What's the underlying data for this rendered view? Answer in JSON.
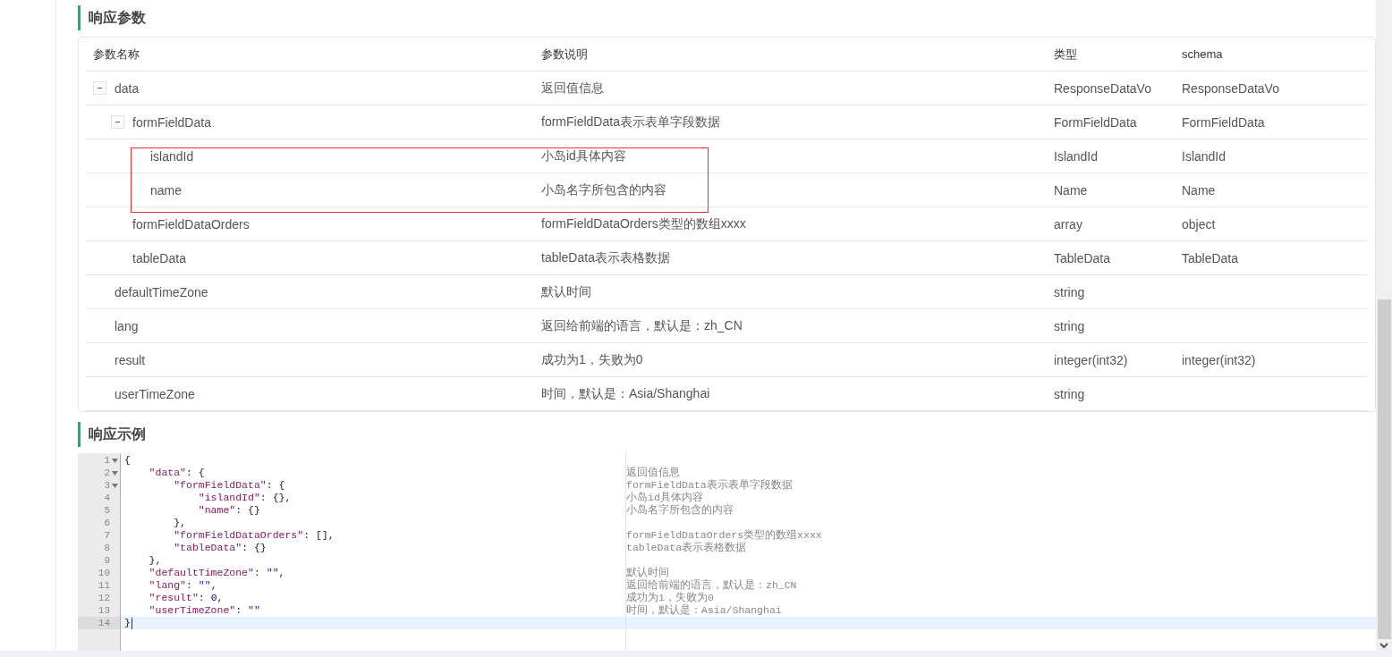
{
  "response_params": {
    "title": "响应参数",
    "columns": [
      "参数名称",
      "参数说明",
      "类型",
      "schema"
    ],
    "rows": [
      {
        "name": "data",
        "description": "返回值信息",
        "type": "ResponseDataVo",
        "schema": "ResponseDataVo",
        "expanded": true,
        "highlighted": false,
        "children": [
          {
            "name": "formFieldData",
            "description": "formFieldData表示表单字段数据",
            "type": "FormFieldData",
            "schema": "FormFieldData",
            "expanded": true,
            "highlighted": false,
            "children": [
              {
                "name": "islandId",
                "description": "小岛id具体内容",
                "type": "IslandId",
                "schema": "IslandId",
                "highlighted": true
              },
              {
                "name": "name",
                "description": "小岛名字所包含的内容",
                "type": "Name",
                "schema": "Name",
                "highlighted": true
              }
            ]
          },
          {
            "name": "formFieldDataOrders",
            "description": "formFieldDataOrders类型的数组xxxx",
            "type": "array",
            "schema": "object",
            "highlighted": false
          },
          {
            "name": "tableData",
            "description": "tableData表示表格数据",
            "type": "TableData",
            "schema": "TableData",
            "highlighted": false
          }
        ]
      },
      {
        "name": "defaultTimeZone",
        "description": "默认时间",
        "type": "string",
        "highlighted": false
      },
      {
        "name": "lang",
        "description": "返回给前端的语言，默认是：zh_CN",
        "type": "string",
        "highlighted": false
      },
      {
        "name": "result",
        "description": "成功为1，失败为0",
        "type": "integer(int32)",
        "schema": "integer(int32)",
        "highlighted": false
      },
      {
        "name": "userTimeZone",
        "description": "时间，默认是：Asia/Shanghai",
        "type": "string",
        "highlighted": false
      }
    ]
  },
  "response_example": {
    "title": "响应示例",
    "lines": [
      {
        "number": "1",
        "foldable": true,
        "active": false,
        "tokens": [
          {
            "kind": "punct",
            "text": "{"
          }
        ]
      },
      {
        "number": "2",
        "foldable": true,
        "active": false,
        "comment": "返回值信息",
        "tokens": [
          {
            "kind": "key",
            "text": "    \"data\""
          },
          {
            "kind": "punct",
            "text": ": {"
          }
        ]
      },
      {
        "number": "3",
        "foldable": true,
        "active": false,
        "comment": "formFieldData表示表单字段数据",
        "tokens": [
          {
            "kind": "key",
            "text": "        \"formFieldData\""
          },
          {
            "kind": "punct",
            "text": ": {"
          }
        ]
      },
      {
        "number": "4",
        "foldable": false,
        "active": false,
        "comment": "小岛id具体内容",
        "tokens": [
          {
            "kind": "key",
            "text": "            \"islandId\""
          },
          {
            "kind": "punct",
            "text": ": {},"
          }
        ]
      },
      {
        "number": "5",
        "foldable": false,
        "active": false,
        "comment": "小岛名字所包含的内容",
        "tokens": [
          {
            "kind": "key",
            "text": "            \"name\""
          },
          {
            "kind": "punct",
            "text": ": {}"
          }
        ]
      },
      {
        "number": "6",
        "foldable": false,
        "active": false,
        "tokens": [
          {
            "kind": "punct",
            "text": "        },"
          }
        ]
      },
      {
        "number": "7",
        "foldable": false,
        "active": false,
        "comment": "formFieldDataOrders类型的数组xxxx",
        "tokens": [
          {
            "kind": "key",
            "text": "        \"formFieldDataOrders\""
          },
          {
            "kind": "punct",
            "text": ": [],"
          }
        ]
      },
      {
        "number": "8",
        "foldable": false,
        "active": false,
        "comment": "tableData表示表格数据",
        "tokens": [
          {
            "kind": "key",
            "text": "        \"tableData\""
          },
          {
            "kind": "punct",
            "text": ": {}"
          }
        ]
      },
      {
        "number": "9",
        "foldable": false,
        "active": false,
        "tokens": [
          {
            "kind": "punct",
            "text": "    },"
          }
        ]
      },
      {
        "number": "10",
        "foldable": false,
        "active": false,
        "comment": "默认时间",
        "tokens": [
          {
            "kind": "key",
            "text": "    \"defaultTimeZone\""
          },
          {
            "kind": "punct",
            "text": ": "
          },
          {
            "kind": "string",
            "text": "\"\""
          },
          {
            "kind": "punct",
            "text": ","
          }
        ]
      },
      {
        "number": "11",
        "foldable": false,
        "active": false,
        "comment": "返回给前端的语言，默认是：zh_CN",
        "tokens": [
          {
            "kind": "key",
            "text": "    \"lang\""
          },
          {
            "kind": "punct",
            "text": ": "
          },
          {
            "kind": "string",
            "text": "\"\""
          },
          {
            "kind": "punct",
            "text": ","
          }
        ]
      },
      {
        "number": "12",
        "foldable": false,
        "active": false,
        "comment": "成功为1，失败为0",
        "tokens": [
          {
            "kind": "key",
            "text": "    \"result\""
          },
          {
            "kind": "punct",
            "text": ": "
          },
          {
            "kind": "number",
            "text": "0"
          },
          {
            "kind": "punct",
            "text": ","
          }
        ]
      },
      {
        "number": "13",
        "foldable": false,
        "active": false,
        "comment": "时间，默认是：Asia/Shanghai",
        "tokens": [
          {
            "kind": "key",
            "text": "    \"userTimeZone\""
          },
          {
            "kind": "punct",
            "text": ": "
          },
          {
            "kind": "string",
            "text": "\"\""
          }
        ]
      },
      {
        "number": "14",
        "foldable": false,
        "active": true,
        "tokens": [
          {
            "kind": "punct",
            "text": "}"
          }
        ]
      }
    ]
  }
}
